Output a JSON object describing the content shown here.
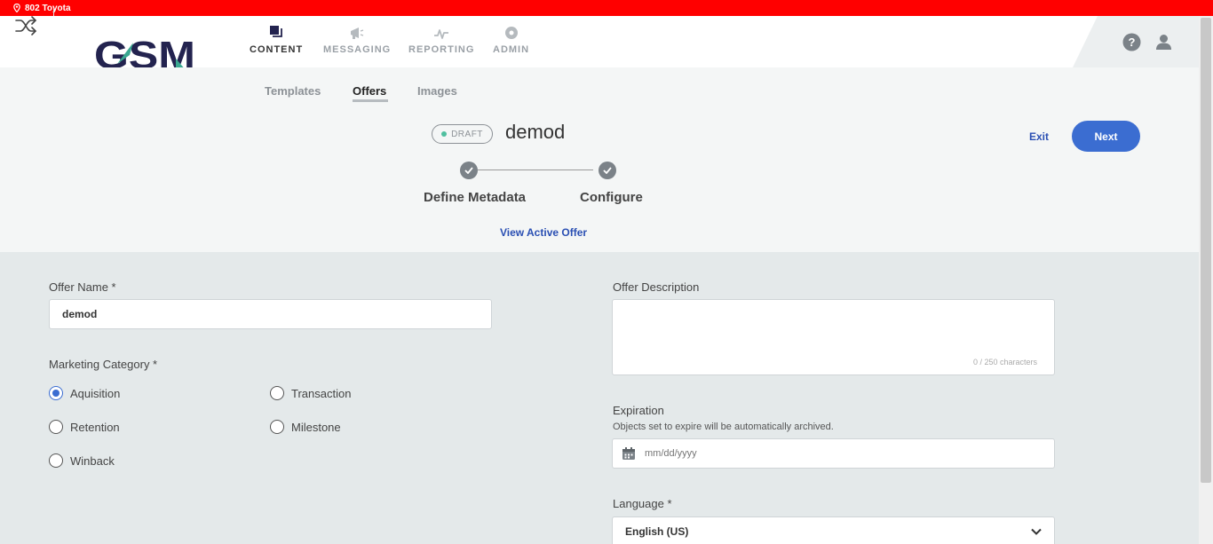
{
  "location": {
    "label": "802 Toyota",
    "icon": "location-pin-icon",
    "bar_color": "#ff0000"
  },
  "header": {
    "logo_text": "GSM",
    "brand_colors": {
      "navy": "#23234f",
      "teal": "#3aa890"
    },
    "nav": [
      {
        "label": "CONTENT",
        "icon": "content-icon",
        "active": true
      },
      {
        "label": "MESSAGING",
        "icon": "megaphone-icon",
        "active": false
      },
      {
        "label": "REPORTING",
        "icon": "activity-icon",
        "active": false
      },
      {
        "label": "ADMIN",
        "icon": "gear-icon",
        "active": false
      }
    ]
  },
  "subtabs": [
    {
      "label": "Templates",
      "active": false
    },
    {
      "label": "Offers",
      "active": true
    },
    {
      "label": "Images",
      "active": false
    }
  ],
  "status_badge": "DRAFT",
  "offer_title": "demod",
  "actions": {
    "exit_label": "Exit",
    "next_label": "Next",
    "accent": "#3b6dd1"
  },
  "steps": [
    {
      "label": "Define Metadata",
      "complete": true
    },
    {
      "label": "Configure",
      "complete": true
    }
  ],
  "view_active_offer": "View Active Offer",
  "form": {
    "offer_name_label": "Offer Name *",
    "offer_name_value": "demod",
    "marketing_category_label": "Marketing Category *",
    "categories": [
      {
        "label": "Aquisition",
        "checked": true
      },
      {
        "label": "Transaction",
        "checked": false
      },
      {
        "label": "Retention",
        "checked": false
      },
      {
        "label": "Milestone",
        "checked": false
      },
      {
        "label": "Winback",
        "checked": false
      }
    ],
    "description_label": "Offer Description",
    "description_value": "",
    "description_counter": "0 / 250 characters",
    "expiration_label": "Expiration",
    "expiration_help": "Objects set to expire will be automatically archived.",
    "expiration_placeholder": "mm/dd/yyyy",
    "language_label": "Language *",
    "language_value": "English (US)"
  }
}
